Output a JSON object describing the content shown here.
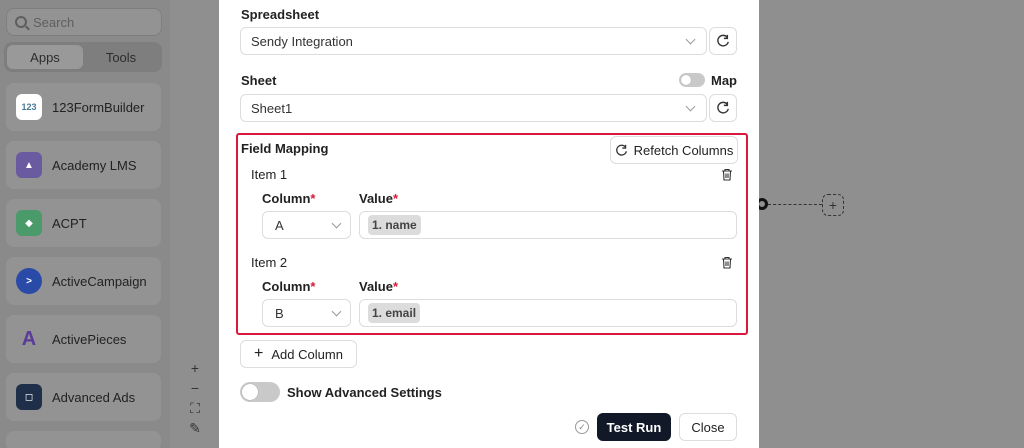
{
  "sidebar": {
    "search_placeholder": "Search",
    "tabs": [
      {
        "label": "Apps",
        "active": true
      },
      {
        "label": "Tools",
        "active": false
      }
    ],
    "apps": [
      {
        "label": "123FormBuilder",
        "icon": "123formbuilder-icon",
        "color": "#4a7a9a"
      },
      {
        "label": "Academy LMS",
        "icon": "academy-lms-icon",
        "color": "#5a4a8a"
      },
      {
        "label": "ACPT",
        "icon": "acpt-icon",
        "color": "#3a8a5a"
      },
      {
        "label": "ActiveCampaign",
        "icon": "activecampaign-icon",
        "color": "#1f3f9a"
      },
      {
        "label": "ActivePieces",
        "icon": "activepieces-icon",
        "color": "#5a3a9a"
      },
      {
        "label": "Advanced Ads",
        "icon": "advanced-ads-icon",
        "color": "#1f2f4a"
      }
    ]
  },
  "modal": {
    "spreadsheet_label": "Spreadsheet",
    "spreadsheet_value": "Sendy Integration",
    "sheet_label": "Sheet",
    "map_label": "Map",
    "sheet_value": "Sheet1",
    "field_mapping_label": "Field Mapping",
    "refetch_label": "Refetch Columns",
    "items": [
      {
        "title": "Item 1",
        "column_label": "Column",
        "value_label": "Value",
        "column_value": "A",
        "value_tag": "1. name"
      },
      {
        "title": "Item 2",
        "column_label": "Column",
        "value_label": "Value",
        "column_value": "B",
        "value_tag": "1. email"
      }
    ],
    "required_mark": "*",
    "add_column_label": "Add Column",
    "advanced_label": "Show Advanced Settings",
    "test_run_label": "Test Run",
    "close_label": "Close"
  },
  "zoom": {
    "plus": "+",
    "minus": "−",
    "fit": "⛶",
    "magic": "✎"
  },
  "colors": {
    "accent": "#d8193b",
    "primary_button": "#111827"
  }
}
